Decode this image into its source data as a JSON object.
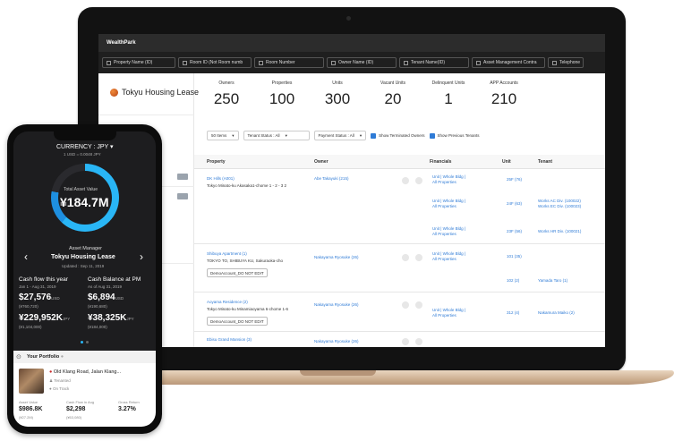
{
  "laptop": {
    "app_title": "WealthPark",
    "filters": [
      "Property Name (ID)",
      "Room ID (Not Room numb",
      "Room Number",
      "Owner Name (ID)",
      "Tenant Name(ID)",
      "Asset Management Contra",
      "Telephone"
    ],
    "brand": "Tokyu Housing Lease",
    "stats": [
      {
        "label": "Owners",
        "value": "250"
      },
      {
        "label": "Properties",
        "value": "100"
      },
      {
        "label": "Units",
        "value": "300"
      },
      {
        "label": "Vacant Units",
        "value": "20"
      },
      {
        "label": "Delinquent Units",
        "value": "1"
      },
      {
        "label": "APP Accounts",
        "value": "210"
      }
    ],
    "controls": {
      "items": "50 Items",
      "tenant_status": "Tenant Status : All",
      "payment_status": "Payment Status : All",
      "show_terminated": "Show Terminated Owners",
      "show_previous": "Show Previous Tenants"
    },
    "table": {
      "headers": [
        "Property",
        "Owner",
        "Financials",
        "Unit",
        "Tenant"
      ],
      "rows": [
        {
          "property": "DK Hills (A001)",
          "address": "Tokyo Minato-ku Akasaka1-chome 1 - 2 - 3 2",
          "owner": "Abe Takayuki (215)",
          "financials": [
            "Unit | Whole Bldg |",
            "All Properties"
          ],
          "units": [
            "25F (76)",
            "24F (63)",
            "23F (56)"
          ],
          "tenants": [
            "",
            "Works AC Div. (100022)",
            "Works HR Div. (100021)"
          ],
          "tenant_extra": "Works EC Div. (100023)",
          "financials_extra": [
            "Unit | Whole Bldg |",
            "All Properties",
            "Unit | Whole Bldg |",
            "All Properties"
          ]
        },
        {
          "property": "Shibuya Apartment (1)",
          "address": "TOKYO TO, SHIBUYA KU, Sakuraoka-cho",
          "owner": "Nakayama Ryosuke (26)",
          "financials": [
            "Unit | Whole Bldg |",
            "All Properties"
          ],
          "units": [
            "101 (35)",
            "102 (2)"
          ],
          "tenants": [
            "",
            "Yamada Taro (1)"
          ],
          "demo": "DemoAccount_DO NOT EDIT"
        },
        {
          "property": "Aoyama Residence (2)",
          "address": "Tokyo Minato-ku Minamiaoyama 6-chome 1-6",
          "owner": "Nakayama Ryosuke (26)",
          "financials": [
            "Unit | Whole Bldg |",
            "All Properties"
          ],
          "units": [
            "312 (4)"
          ],
          "tenants": [
            "Nakamura Maiko (2)"
          ],
          "demo": "DemoAccount_DO NOT EDIT"
        },
        {
          "property": "Ebisu Grand Mansion (3)",
          "owner": "Nakayama Ryosuke (26)"
        }
      ]
    }
  },
  "phone": {
    "currency": "CURRENCY : JPY",
    "rate": "1 USD = 0.0048 JPY",
    "total_label": "Total Asset Value",
    "total_value": "¥184.7M",
    "manager_label": "Asset Manager",
    "manager_name": "Tokyu Housing Lease",
    "updated": "Updated : Sep 11, 2019",
    "cash_flow_label": "Cash flow this year",
    "cash_flow_period": "Jan 1 - Aug 31, 2019",
    "cash_flow_usd": "$27,576",
    "cash_flow_usd_unit": "USD",
    "cash_flow_sub": "(¥760,720)",
    "cash_flow_jpy": "¥229,952K",
    "cash_flow_jpy_unit": "JPY",
    "cash_flow_jpy_sub": "(¥1,104,000)",
    "balance_label": "Cash Balance at PM",
    "balance_period": "As of Aug 31, 2019",
    "balance_usd": "$6,894",
    "balance_usd_unit": "USD",
    "balance_sub": "(¥190,680)",
    "balance_jpy": "¥38,325K",
    "balance_jpy_unit": "JPY",
    "balance_jpy_sub": "(¥184,000)",
    "portfolio_title": "Your Portfolio",
    "property_name": "Old Klang Road, Jalan Klang...",
    "status1": "Tenanted",
    "status2": "On Track",
    "asset_value_label": "Asset Value",
    "asset_value": "$986.8K",
    "asset_value_sub": "(¥27.2M)",
    "cashflow_aug_label": "Cash Flow in Aug",
    "cashflow_aug": "$2,298",
    "cashflow_aug_sub": "(¥63,080)",
    "gross_return_label": "Gross Return",
    "gross_return": "3.27%",
    "colors": {
      "ring": "#29b6f6",
      "link": "#2f7bd6"
    }
  }
}
